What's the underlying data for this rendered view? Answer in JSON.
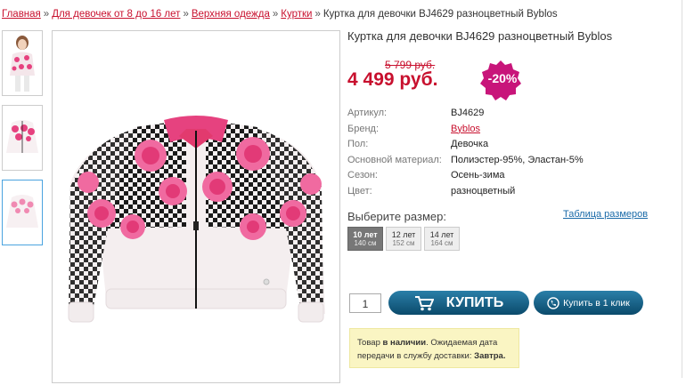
{
  "breadcrumb": {
    "items": [
      "Главная",
      "Для девочек от 8 до 16 лет",
      "Верхняя одежда",
      "Куртки"
    ],
    "current": "Куртка для девочки BJ4629 разноцветный Byblos",
    "separator": "»"
  },
  "product": {
    "title": "Куртка для девочки BJ4629 разноцветный Byblos",
    "old_price": "5 799 руб.",
    "price": "4 499 руб.",
    "discount": "-20%",
    "specs": [
      {
        "label": "Артикул:",
        "value": "BJ4629"
      },
      {
        "label": "Бренд:",
        "value": "Byblos"
      },
      {
        "label": "Пол:",
        "value": "Девочка"
      },
      {
        "label": "Основной материал:",
        "value": "Полиэстер-95%, Эластан-5%"
      },
      {
        "label": "Сезон:",
        "value": "Осень-зима"
      },
      {
        "label": "Цвет:",
        "value": "разноцветный"
      }
    ]
  },
  "sizes": {
    "title": "Выберите размер:",
    "table_link": "Таблица размеров",
    "options": [
      {
        "label": "10 лет",
        "sub": "140 см",
        "selected": true
      },
      {
        "label": "12 лет",
        "sub": "152 см",
        "selected": false
      },
      {
        "label": "14 лет",
        "sub": "164 см",
        "selected": false
      }
    ]
  },
  "cart": {
    "quantity": "1",
    "buy_label": "КУПИТЬ",
    "one_click_label": "Купить в 1 клик"
  },
  "stock": {
    "prefix": "Товар ",
    "status": "в наличии",
    "middle": ". Ожидаемая дата передачи в службу доставки: ",
    "date": "Завтра."
  },
  "colors": {
    "accent_red": "#c8102e",
    "button_blue": "#0b4a6b",
    "discount_magenta": "#c8157a"
  },
  "icons": [
    "cart-icon",
    "phone-icon"
  ]
}
